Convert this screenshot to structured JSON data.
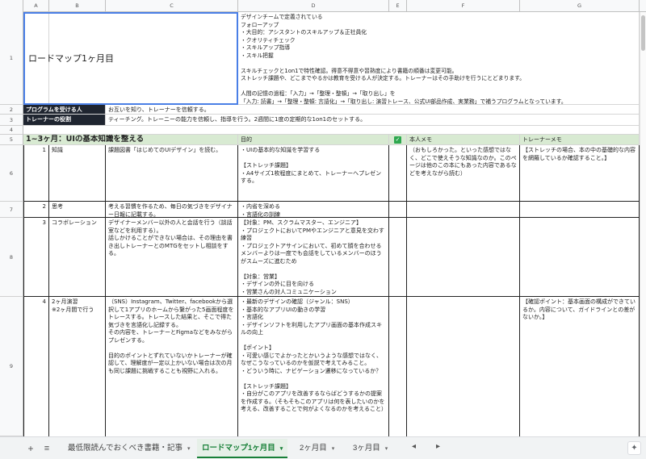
{
  "columns": [
    "A",
    "B",
    "C",
    "D",
    "E",
    "F",
    "G"
  ],
  "rows": [
    "1",
    "2",
    "3",
    "4",
    "5",
    "6",
    "7",
    "8",
    "9"
  ],
  "r1": {
    "title": "ロードマップ1ヶ月目",
    "desc": "デザインチームで定義されている\nフォローアップ\n・大目的：アシスタントのスキルアップ＆正社員化\n・クオリティチェック\n・スキルアップ指導\n・スキル把握\n\nスキルチェックと1on1で特性確認。得意不得意や習熟度により書籍の順番は変更可能。\nストレッチ課題や、どこまでやるかは教育を受ける人が決定する。トレーナーはその手助けを行うにとどまります。\n\n人間の記憶の過程：「入力」→「整理・整頓」→「取り出し」を\n「入力: 読書」→「整理・整頓: 言語化」→「取り出し: 演習トレース、公式UI部品作成、実業務」で補うプログラムとなっています。"
  },
  "r2": {
    "label": "プログラムを受ける人",
    "value": "お互いを知り、トレーナーを信頼する。"
  },
  "r3": {
    "label": "トレーナーの役割",
    "value": "ティーチング。トレーニーの能力を信頼し、指導を行う。2週間に1度の定期的な1on1のセットする。"
  },
  "r5": {
    "title": "1~3ヶ月：UIの基本知識を整える",
    "purpose": "目的",
    "check": "✓",
    "self_memo": "本人メモ",
    "trainer_memo": "トレーナーメモ"
  },
  "items": [
    {
      "num": "1",
      "name": "知識",
      "task": "課題図書「はじめてのUIデザイン」を読む。",
      "purpose": "・UIの基本的な知識を学習する\n\n【ストレッチ課題】\n・A4サイズ1枚程度にまとめて、トレーナーへプレゼンする。",
      "memo": "（おもしろかった。といった感想ではなく、どこで使えそうな知識なのか。このページは他のこの本にもあった内容であるなどを考えながら読む）",
      "trainer": "【ストレッチの場合、本の中の基礎的な内容を網羅しているか確認すること。】"
    },
    {
      "num": "2",
      "name": "思考",
      "task": "考える習慣を作るため、毎日の気づきをデザイナー日報に記載する。",
      "purpose": "・内省を深める\n・言語化の訓練",
      "memo": "",
      "trainer": ""
    },
    {
      "num": "3",
      "name": "コラボレーション",
      "task": "デザイナーメンバー以外の人と会話を行う（談話室などを利用する）。\n話しかけることができない場合は、その理由を書き出しトレーナーとのMTGをセットし相談をする。",
      "purpose": "【対象：PM、スクラムマスター、エンジニア】\n・プロジェクトにおいてPMやエンジニアと意見を交わす練習\n・プロジェクトアサインにおいて、初めて顔を合わせるメンバーよりは一度でも会話をしているメンバーのほうがスムーズに進むため\n\n【対象：営業】\n・デザインの外に目を向ける\n・営業さんの対人コミュニケーション",
      "memo": "",
      "trainer": ""
    },
    {
      "num": "4",
      "name": "2ヶ月演習\n※2ヶ月間で行う",
      "task": "（SNS）Instagram、Twitter、facebookから選択して1アプリのホームから繋がった5画面程度をトレースする。トレースした結果と、そこで得た気づきを言語化し記録する。\nその内容を、トレーナーとFigmaなどをみながらプレゼンする。\n\n目的のポイントとずれていないかトレーナーが確認して、理解度が一定以上かいない場合は次の月も同じ課題に挑戦することも視野に入れる。",
      "purpose": "・最新のデザインの確認（ジャンル：SNS）\n・基本的なアプリUIの動きの学習\n・言語化\n・デザインソフトを利用したアプリ画面の基本作成スキルの向上\n\n【ポイント】\n・可愛い感じでよかったとかいうような感想ではなく、なぜこうなっているのかを仮説で考えてみること。\n・どういう時に、ナビゲーション遷移になっているか？\n\n【ストレッチ課題】\n・自分がこのアプリを改善するならばどうするかの提案を作成する。（そもそもこのアプリは何を表したいのかを考える、改善することで何がよくなるのかを考えること）",
      "memo": "",
      "trainer": "【確認ポイント：基本画面の構成ができているか。内容について、ガイドラインとの差がないか。】"
    }
  ],
  "tabs": {
    "add": "+",
    "list": "≡",
    "items": [
      {
        "label": "最低限読んでおくべき書籍・記事",
        "active": false
      },
      {
        "label": "ロードマップ1ヶ月目",
        "active": true
      },
      {
        "label": "2ヶ月目",
        "active": false
      },
      {
        "label": "3ヶ月目",
        "active": false
      }
    ],
    "caret": "▾",
    "prev": "◂",
    "next": "▸",
    "explore": "✦"
  }
}
